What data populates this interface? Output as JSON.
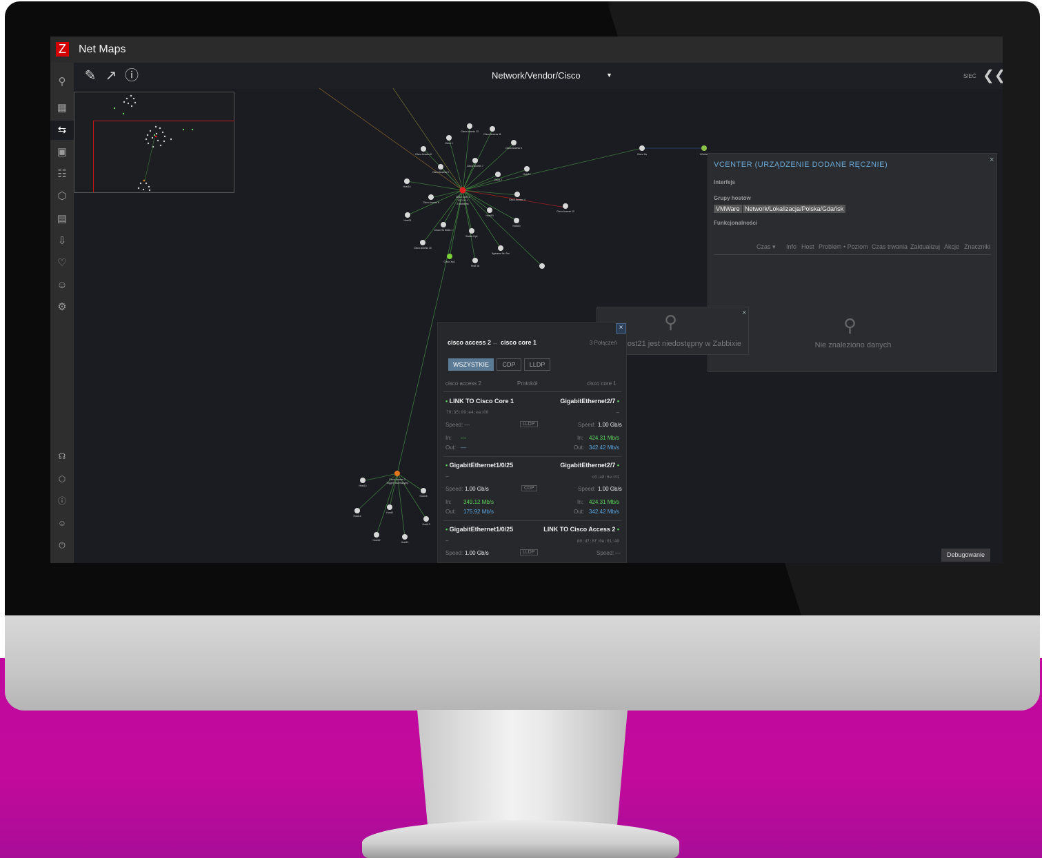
{
  "app": {
    "title": "Net Maps",
    "logo": "Z"
  },
  "toolbar": {
    "breadcrumb": "Network/Vendor/Cisco",
    "breadcrumb_caret": "▼",
    "network_label": "SIEĆ"
  },
  "sidebar": {
    "icons": [
      "search-icon",
      "dashboard-icon",
      "netmaps-icon",
      "monitoring-icon",
      "topology-icon",
      "inventory-icon",
      "reports-icon",
      "data-collection-icon",
      "alerts-icon",
      "users-icon",
      "settings-icon",
      "support-icon",
      "integrations-icon",
      "help-icon",
      "user-icon",
      "logout-icon"
    ]
  },
  "map": {
    "nodes": [
      {
        "label": "Cisco Core 1",
        "status": "problem"
      },
      {
        "label": "Cisco Access 13"
      },
      {
        "label": "Cisco Access 11"
      },
      {
        "label": "Cisco 1"
      },
      {
        "label": "Cisco Access 5"
      },
      {
        "label": "Cisco Access 8"
      },
      {
        "label": "Cisco Access 7"
      },
      {
        "label": "Cisco Access 9"
      },
      {
        "label": "Cisco 2"
      },
      {
        "label": "Host17"
      },
      {
        "label": "Host16"
      },
      {
        "label": "Cisco Access 6"
      },
      {
        "label": "Cisco Access 4"
      },
      {
        "label": "Cisco Access 12"
      },
      {
        "label": "Host21"
      },
      {
        "label": "Host19"
      },
      {
        "label": "Host20"
      },
      {
        "label": "Cisco Hu Nodo 1"
      },
      {
        "label": "Switch Hp1"
      },
      {
        "label": "Cisco Access 10"
      },
      {
        "label": "Ilgarama Nu Sai"
      },
      {
        "label": "Cisco Xg 1"
      },
      {
        "label": "Host 18"
      },
      {
        "label": "Cisco Hs"
      },
      {
        "label": "VCenter"
      },
      {
        "label": "Cisco Access 2"
      },
      {
        "label": "Host10"
      },
      {
        "label": "Host15"
      },
      {
        "label": "Host14"
      },
      {
        "label": "Host8"
      },
      {
        "label": "Host13"
      },
      {
        "label": "Host12"
      },
      {
        "label": "Host11"
      }
    ],
    "core_sublabels": [
      "127.0.0.1",
      "2 problems"
    ],
    "access2_sublabel": "Trigger Informacyjny"
  },
  "vcenter_panel": {
    "title": "VCENTER (URZĄDZENIE DODANE RĘCZNIE)",
    "close": "×",
    "interface_label": "Interfejs",
    "hostgroups_label": "Grupy hostów",
    "hostgroups": [
      "VMWare",
      "Network/Lokalizacja/Polska/Gdańsk"
    ],
    "features_label": "Funkcjonalności",
    "columns": [
      "Czas ▾",
      "Info",
      "Host",
      "Problem • Poziom",
      "Czas trwania",
      "Zaktualizuj",
      "Akcje",
      "Znaczniki"
    ],
    "empty_message": "Nie znaleziono danych"
  },
  "unreachable_popup": {
    "message": "Host host21 jest niedostępny w Zabbixie",
    "close": "×"
  },
  "connection_panel": {
    "title_left": "cisco access 2",
    "arrow": "↔",
    "title_right": "cisco core 1",
    "count": "3 Połączeń",
    "close": "×",
    "tabs": [
      "WSZYSTKIE",
      "CDP",
      "LLDP"
    ],
    "col_left": "cisco access 2",
    "col_mid": "Protokół",
    "col_right": "cisco core 1",
    "speed_label": "Speed:",
    "in_label": "In:",
    "out_label": "Out:",
    "links": [
      {
        "left_if": "LINK TO Cisco Core 1",
        "right_if": "GigabitEthernet2/7",
        "left_mac": "70:35:09:e4:ea:00",
        "right_mac": "–",
        "protocol": "LLDP",
        "left_speed": "—",
        "right_speed": "1.00 Gb/s",
        "left_in": "—",
        "left_out": "—",
        "right_in": "424.31 Mb/s",
        "right_out": "342.42 Mb/s"
      },
      {
        "left_if": "GigabitEthernet1/0/25",
        "right_if": "GigabitEthernet2/7",
        "left_mac": "–",
        "right_mac": "c0:a8:6e:01",
        "protocol": "CDP",
        "left_speed": "1.00 Gb/s",
        "right_speed": "1.00 Gb/s",
        "left_in": "349.12 Mb/s",
        "left_out": "175.92 Mb/s",
        "right_in": "424.31 Mb/s",
        "right_out": "342.42 Mb/s"
      },
      {
        "left_if": "GigabitEthernet1/0/25",
        "right_if": "LINK TO Cisco Access 2",
        "left_mac": "–",
        "right_mac": "00:d7:8f:0e:01:40",
        "protocol": "LLDP",
        "left_speed": "1.00 Gb/s",
        "right_speed": "—"
      }
    ]
  },
  "debug_button": "Debugowanie"
}
